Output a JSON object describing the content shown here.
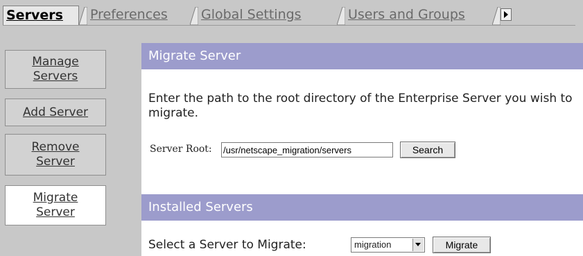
{
  "tabs": [
    {
      "label": "Servers",
      "active": true
    },
    {
      "label": "Preferences",
      "active": false
    },
    {
      "label": "Global Settings",
      "active": false
    },
    {
      "label": "Users and Groups",
      "active": false
    }
  ],
  "nav": [
    {
      "label": "Manage Servers",
      "line1": "Manage",
      "line2": "Servers",
      "active": false
    },
    {
      "label": "Add Server",
      "active": false
    },
    {
      "label": "Remove Server",
      "line1": "Remove",
      "line2": "Server",
      "active": false
    },
    {
      "label": "Migrate Server",
      "line1": "Migrate",
      "line2": "Server",
      "active": true
    }
  ],
  "migrate": {
    "title": "Migrate Server",
    "intro": "Enter the path to the root directory of the Enterprise Server you wish to migrate.",
    "server_root_label": "Server Root:",
    "server_root_value": "/usr/netscape_migration/servers",
    "search_button": "Search"
  },
  "installed": {
    "title": "Installed Servers",
    "select_label": "Select a Server to Migrate:",
    "selected_server": "migration",
    "migrate_button": "Migrate"
  },
  "colors": {
    "section_bar": "#9c9ccc",
    "chrome_gray": "#c8c8c8"
  },
  "icons": {
    "more_tabs": "arrow-right-icon",
    "dropdown": "chevron-down-icon"
  }
}
